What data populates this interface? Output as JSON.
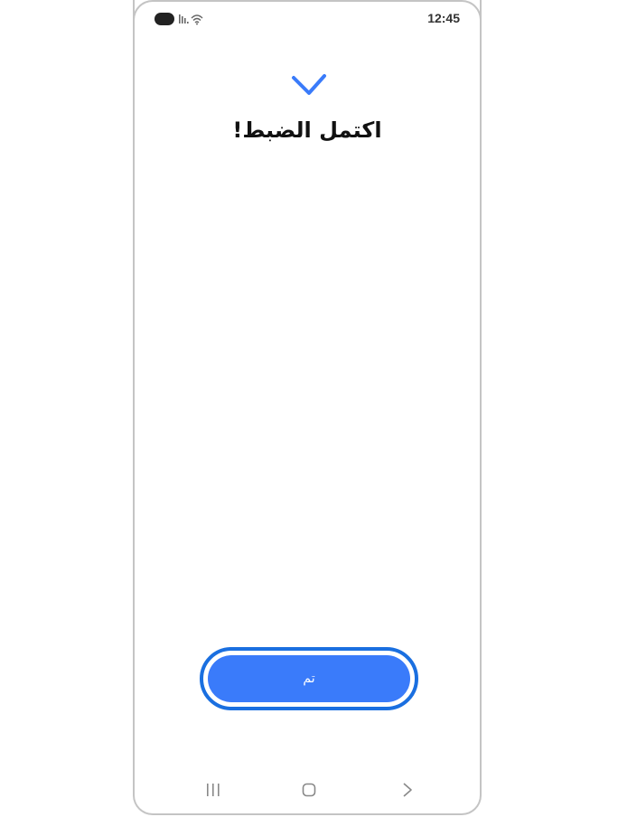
{
  "status_bar": {
    "time": "12:45",
    "icons": [
      "camera-pill",
      "signal-icon",
      "wifi-icon"
    ]
  },
  "main": {
    "check_icon": "check-icon",
    "title": "اكتمل الضبط!",
    "done_label": "تم"
  },
  "nav_bar": {
    "icons": [
      "recents-icon",
      "home-icon",
      "back-icon"
    ]
  },
  "colors": {
    "accent": "#3a7bfa",
    "accent_outline": "#1a6fe0",
    "title": "#111111",
    "frame": "#c4c4c4"
  }
}
